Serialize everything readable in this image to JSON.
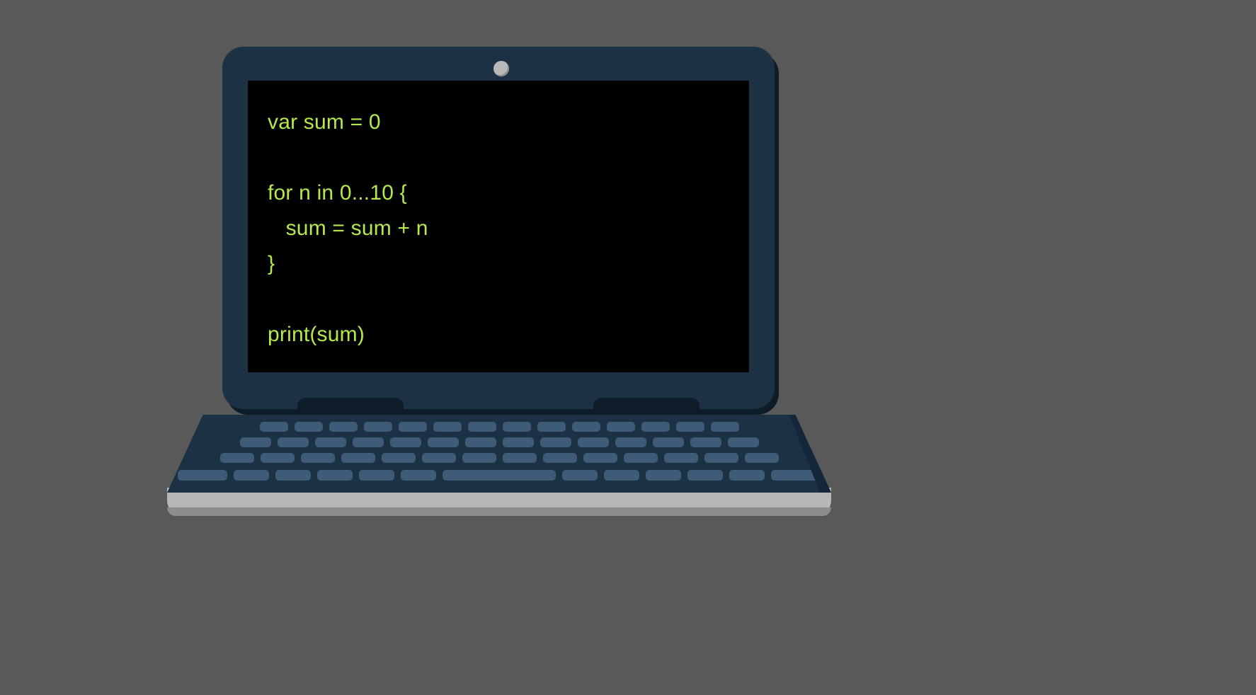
{
  "code": {
    "line1": "var sum = 0",
    "line2": "",
    "line3": "for n in 0...10 {",
    "line4": "   sum = sum + n",
    "line5": "}",
    "line6": "",
    "line7": "print(sum)"
  }
}
